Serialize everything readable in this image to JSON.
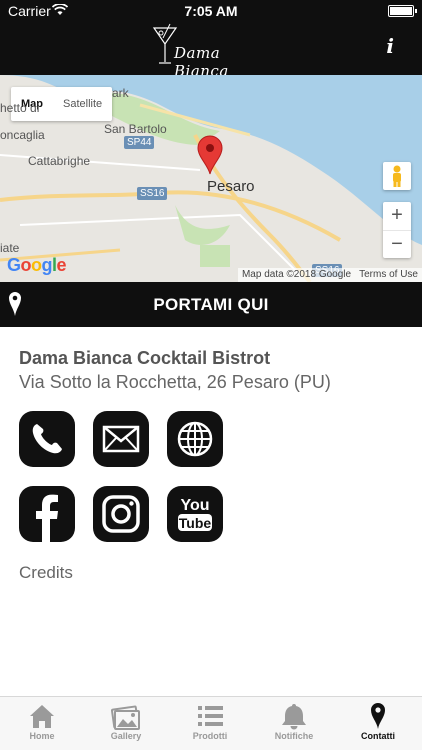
{
  "status_bar": {
    "carrier": "Carrier",
    "time": "7:05 AM"
  },
  "header": {
    "logo_text": "Dama Bianca",
    "info_label": "i"
  },
  "map": {
    "type_options": [
      "Map",
      "Satellite"
    ],
    "labels": [
      "Pesaro",
      "Cattabrighe",
      "San Bartolo",
      "ark",
      "hetto di",
      "oncaglia",
      "iate"
    ],
    "road_shields": [
      "SP44",
      "SS16",
      "SS16"
    ],
    "google_logo": "Google",
    "attribution": "Map data ©2018 Google",
    "terms": "Terms of Use",
    "zoom_in": "+",
    "zoom_out": "−",
    "colors": {
      "sea": "#a8cfe8",
      "land": "#e8e6e1",
      "park": "#c8e3b4",
      "pin": "#e53935"
    }
  },
  "directions": {
    "label": "PORTAMI QUI"
  },
  "venue": {
    "name": "Dama Bianca Cocktail Bistrot",
    "address": "Via Sotto la Rocchetta, 26 Pesaro (PU)"
  },
  "contact_buttons": [
    "phone-icon",
    "mail-icon",
    "globe-icon"
  ],
  "social_buttons": [
    "facebook-icon",
    "instagram-icon",
    "youtube-icon"
  ],
  "youtube_text": {
    "top": "You",
    "bottom": "Tube"
  },
  "credits": "Credits",
  "tabs": [
    {
      "label": "Home",
      "icon": "home-icon",
      "active": false
    },
    {
      "label": "Gallery",
      "icon": "gallery-icon",
      "active": false
    },
    {
      "label": "Prodotti",
      "icon": "list-icon",
      "active": false
    },
    {
      "label": "Notifiche",
      "icon": "bell-icon",
      "active": false
    },
    {
      "label": "Contatti",
      "icon": "map-pin-icon",
      "active": true
    }
  ]
}
